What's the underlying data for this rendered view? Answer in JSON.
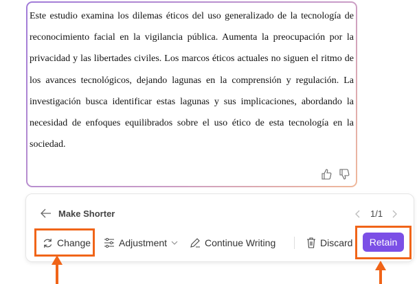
{
  "content": {
    "paragraph": "Este estudio examina los dilemas éticos del uso generalizado de la tecnología de reconocimiento facial en la vigilancia pública. Aumenta la preocupación por la privacidad y las libertades civiles. Los marcos éticos actuales no siguen el ritmo de los avances tecnológicos, dejando lagunas en la comprensión y regulación. La investigación busca identificar estas lagunas y sus implicaciones, abordando la necesidad de enfoques equilibrados sobre el uso ético de esta tecnología en la sociedad."
  },
  "panel": {
    "title": "Make Shorter",
    "pager": "1/1",
    "change": "Change",
    "adjustment": "Adjustment",
    "continue": "Continue Writing",
    "discard": "Discard",
    "retain": "Retain"
  },
  "colors": {
    "accent": "#7b4fe6",
    "highlight": "#f06418"
  }
}
